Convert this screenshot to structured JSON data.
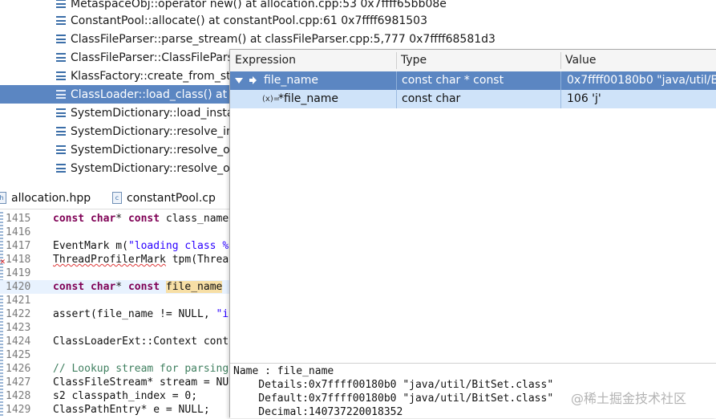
{
  "call_stack": {
    "frames": [
      {
        "label": "MetaspaceObj::operator new() at allocation.cpp:53 0x7ffff65bb08e",
        "selected": false
      },
      {
        "label": "ConstantPool::allocate() at constantPool.cpp:61 0x7ffff6981503",
        "selected": false
      },
      {
        "label": "ClassFileParser::parse_stream() at classFileParser.cpp:5,777 0x7ffff68581d3",
        "selected": false
      },
      {
        "label": "ClassFileParser::ClassFileParse",
        "selected": false
      },
      {
        "label": "KlassFactory::create_from_stre",
        "selected": false
      },
      {
        "label": "ClassLoader::load_class() at cl",
        "selected": true
      },
      {
        "label": "SystemDictionary::load_instan",
        "selected": false
      },
      {
        "label": "SystemDictionary::resolve_ins",
        "selected": false
      },
      {
        "label": "SystemDictionary::resolve_or_",
        "selected": false
      },
      {
        "label": "SystemDictionary::resolve_or_",
        "selected": false
      }
    ]
  },
  "editor_tabs": [
    {
      "label": "allocation.hpp",
      "icon": "header-file-icon"
    },
    {
      "label": "constantPool.cp",
      "icon": "cpp-file-icon"
    }
  ],
  "editor": {
    "lines": [
      {
        "n": "1415"
      },
      {
        "n": "1416"
      },
      {
        "n": "1417"
      },
      {
        "n": "1418"
      },
      {
        "n": "1419"
      },
      {
        "n": "1420"
      },
      {
        "n": "1421"
      },
      {
        "n": "1422"
      },
      {
        "n": "1423"
      },
      {
        "n": "1424"
      },
      {
        "n": "1425"
      },
      {
        "n": "1426"
      },
      {
        "n": "1427"
      },
      {
        "n": "1428"
      },
      {
        "n": "1429"
      }
    ],
    "code": {
      "l1415_kw1": "const",
      "l1415_kw2": "char",
      "l1415_p1": "* ",
      "l1415_kw3": "const",
      "l1415_p2": " class_name",
      "l1417_ty": "EventMark",
      "l1417_p1": " m(",
      "l1417_str": "\"loading class %",
      "l1418_ty": "ThreadProfilerMark",
      "l1418_p1": " tpm(Threa",
      "l1420_kw1": "const",
      "l1420_kw2": "char",
      "l1420_p1": "* ",
      "l1420_kw3": "const",
      "l1420_sp": " ",
      "l1420_hl": "file_name",
      "l1422_p1": "assert(file_name != NULL, ",
      "l1422_str": "\"i",
      "l1424_ty": "ClassLoaderExt",
      "l1424_p1": "::",
      "l1424_ty2": "Context",
      "l1424_p2": " cont",
      "l1426_cm": "// Lookup stream for parsing",
      "l1427_ty": "ClassFileStream",
      "l1427_p1": "* stream = NU",
      "l1428_ty": "s2",
      "l1428_p1": " classpath_index = 0;",
      "l1429_ty": "ClassPathEntry",
      "l1429_p1": "* e = NULL;"
    }
  },
  "expression_popup": {
    "columns": {
      "expression": "Expression",
      "type": "Type",
      "value": "Value"
    },
    "rows": [
      {
        "expression": "file_name",
        "type": "const char * const",
        "value": "0x7ffff00180b0 \"java/util/BitS"
      },
      {
        "expression": "*file_name",
        "type": "const char",
        "value": "106 'j'",
        "icon_text": "(x)="
      }
    ],
    "details": [
      "Name : file_name",
      "    Details:0x7ffff00180b0 \"java/util/BitSet.class\"",
      "    Default:0x7ffff00180b0 \"java/util/BitSet.class\"",
      "    Decimal:140737220018352"
    ]
  },
  "watermark": "@稀土掘金技术社区",
  "colors": {
    "selection": "#5b86c2",
    "selection_light": "#cfe3f9",
    "keyword": "#7f0055",
    "string": "#2a00ff",
    "comment": "#3f7f5f",
    "highlight": "#f7dfa6"
  }
}
